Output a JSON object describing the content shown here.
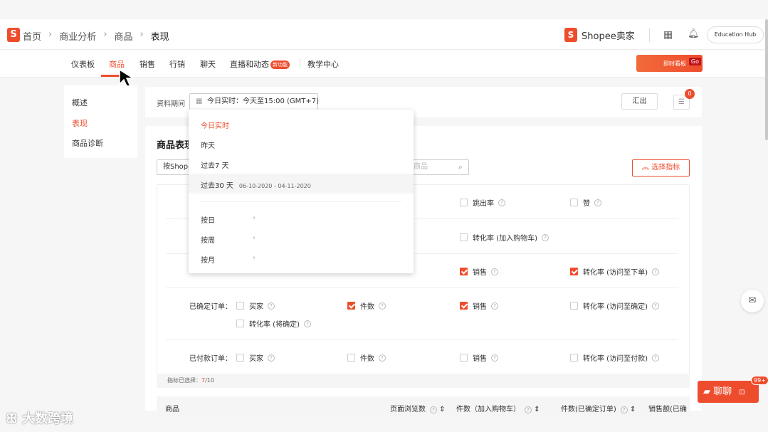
{
  "header": {
    "logo_letter": "S",
    "breadcrumbs": [
      "首页",
      "商业分析",
      "商品",
      "表现"
    ],
    "seller_center": "Shopee卖家",
    "education_hub": "Education Hub"
  },
  "nav": {
    "items": [
      "仪表板",
      "商品",
      "销售",
      "行销",
      "聊天",
      "直播和动态",
      "教学中心"
    ],
    "new_badge": "新功能",
    "live_banner": "即时看板",
    "live_go": "Go"
  },
  "sidebar": {
    "items": [
      "概述",
      "表现",
      "商品诊断"
    ]
  },
  "period": {
    "label": "资料期间",
    "value": "今日实时：今天至15:00 (GMT+7)",
    "export": "汇出",
    "badge": "0"
  },
  "dropdown": {
    "items": [
      "今日实时",
      "昨天",
      "过去7 天",
      "过去30 天",
      "按日",
      "按周",
      "按月"
    ],
    "range": "06-10-2020 - 04-11-2020"
  },
  "performance": {
    "title": "商品表现",
    "shop_select": "按Shopee",
    "search_placeholder": "商品",
    "choose_metrics": "选择指标",
    "metrics": {
      "r1": [
        "跳出率",
        "赞"
      ],
      "r2": [
        "转化率 (加入购物车)"
      ],
      "r3": [
        "销售",
        "转化率 (访问至下单)"
      ],
      "confirmed_label": "已确定订单：",
      "confirmed": [
        "买家",
        "件数",
        "销售",
        "转化率 (访问至确定)",
        "转化率 (将确定)"
      ],
      "paid_label": "已付款订单：",
      "paid": [
        "买家",
        "件数",
        "销售",
        "转化率 (访问至付款)"
      ]
    },
    "selected_label": "指标已选择：",
    "selected_num": "7",
    "selected_total": "/10",
    "table_headers": [
      "商品",
      "页面浏览数",
      "件数（加入购物车）",
      "件数(已确定订单)",
      "销售额(已确"
    ]
  },
  "chat": {
    "label": "聊聊",
    "badge": "99+"
  },
  "watermark": "大数跨境",
  "colors": {
    "accent": "#ee4d2d"
  }
}
